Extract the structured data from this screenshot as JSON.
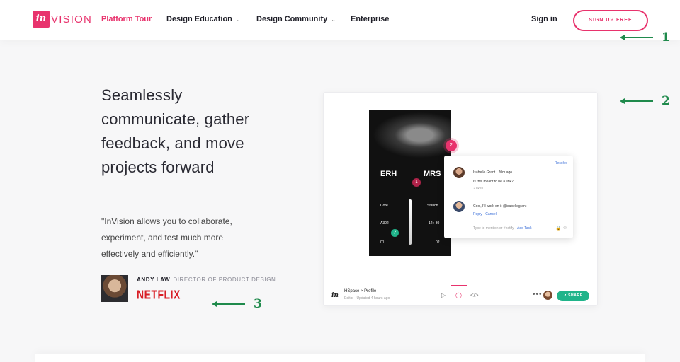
{
  "brand": {
    "logo_mark": "in",
    "logo_word": "VISION",
    "accent": "#e8336d"
  },
  "nav": {
    "items": [
      {
        "label": "Platform Tour",
        "active": true,
        "dropdown": false
      },
      {
        "label": "Design Education",
        "active": false,
        "dropdown": true
      },
      {
        "label": "Design Community",
        "active": false,
        "dropdown": true
      },
      {
        "label": "Enterprise",
        "active": false,
        "dropdown": false
      }
    ],
    "chevron": "⌄",
    "signin": "Sign in",
    "signup": "SIGN UP FREE"
  },
  "hero": {
    "headline_lines": [
      "Seamlessly",
      "communicate, gather",
      "feedback, and move",
      "projects forward"
    ],
    "quote_lines": [
      "\"InVision allows you to collaborate,",
      "experiment, and test much more",
      "effectively and efficiently.\""
    ],
    "author_name": "ANDY LAW",
    "author_title": "DIRECTOR OF PRODUCT DESIGN",
    "company": "NETFLIX"
  },
  "mock": {
    "phone": {
      "left_code": "ERH",
      "right_code": "MRS",
      "pin": "1",
      "rows": [
        {
          "left": "Core 1",
          "right": "Station"
        },
        {
          "left": "A302",
          "right": "12 : 30"
        },
        {
          "left": "01",
          "right": "02"
        }
      ]
    },
    "pin2": "2",
    "comments": {
      "resolve": "Resolve",
      "first_name": "Isabelle Grant",
      "first_time": "20m ago",
      "first_text": "Is this meant to be a link?",
      "first_likes": "2 likes",
      "second_text": "Cool, I'll work on it @isabellegrant",
      "reply": "Reply",
      "cancel": "Cancel",
      "compose": "Type to mention or #notify",
      "add_task": "Add Task"
    },
    "toolbar": {
      "logo": "in",
      "path": "HSpace  >  Profile",
      "sub": "Editor · Updated 4 hours ago",
      "dots": "•••",
      "share": "SHARE"
    }
  },
  "annotations": [
    "1",
    "2",
    "3"
  ],
  "icons": {
    "play": "play-icon",
    "comment": "comment-icon",
    "code": "code-icon",
    "check": "check-icon"
  }
}
